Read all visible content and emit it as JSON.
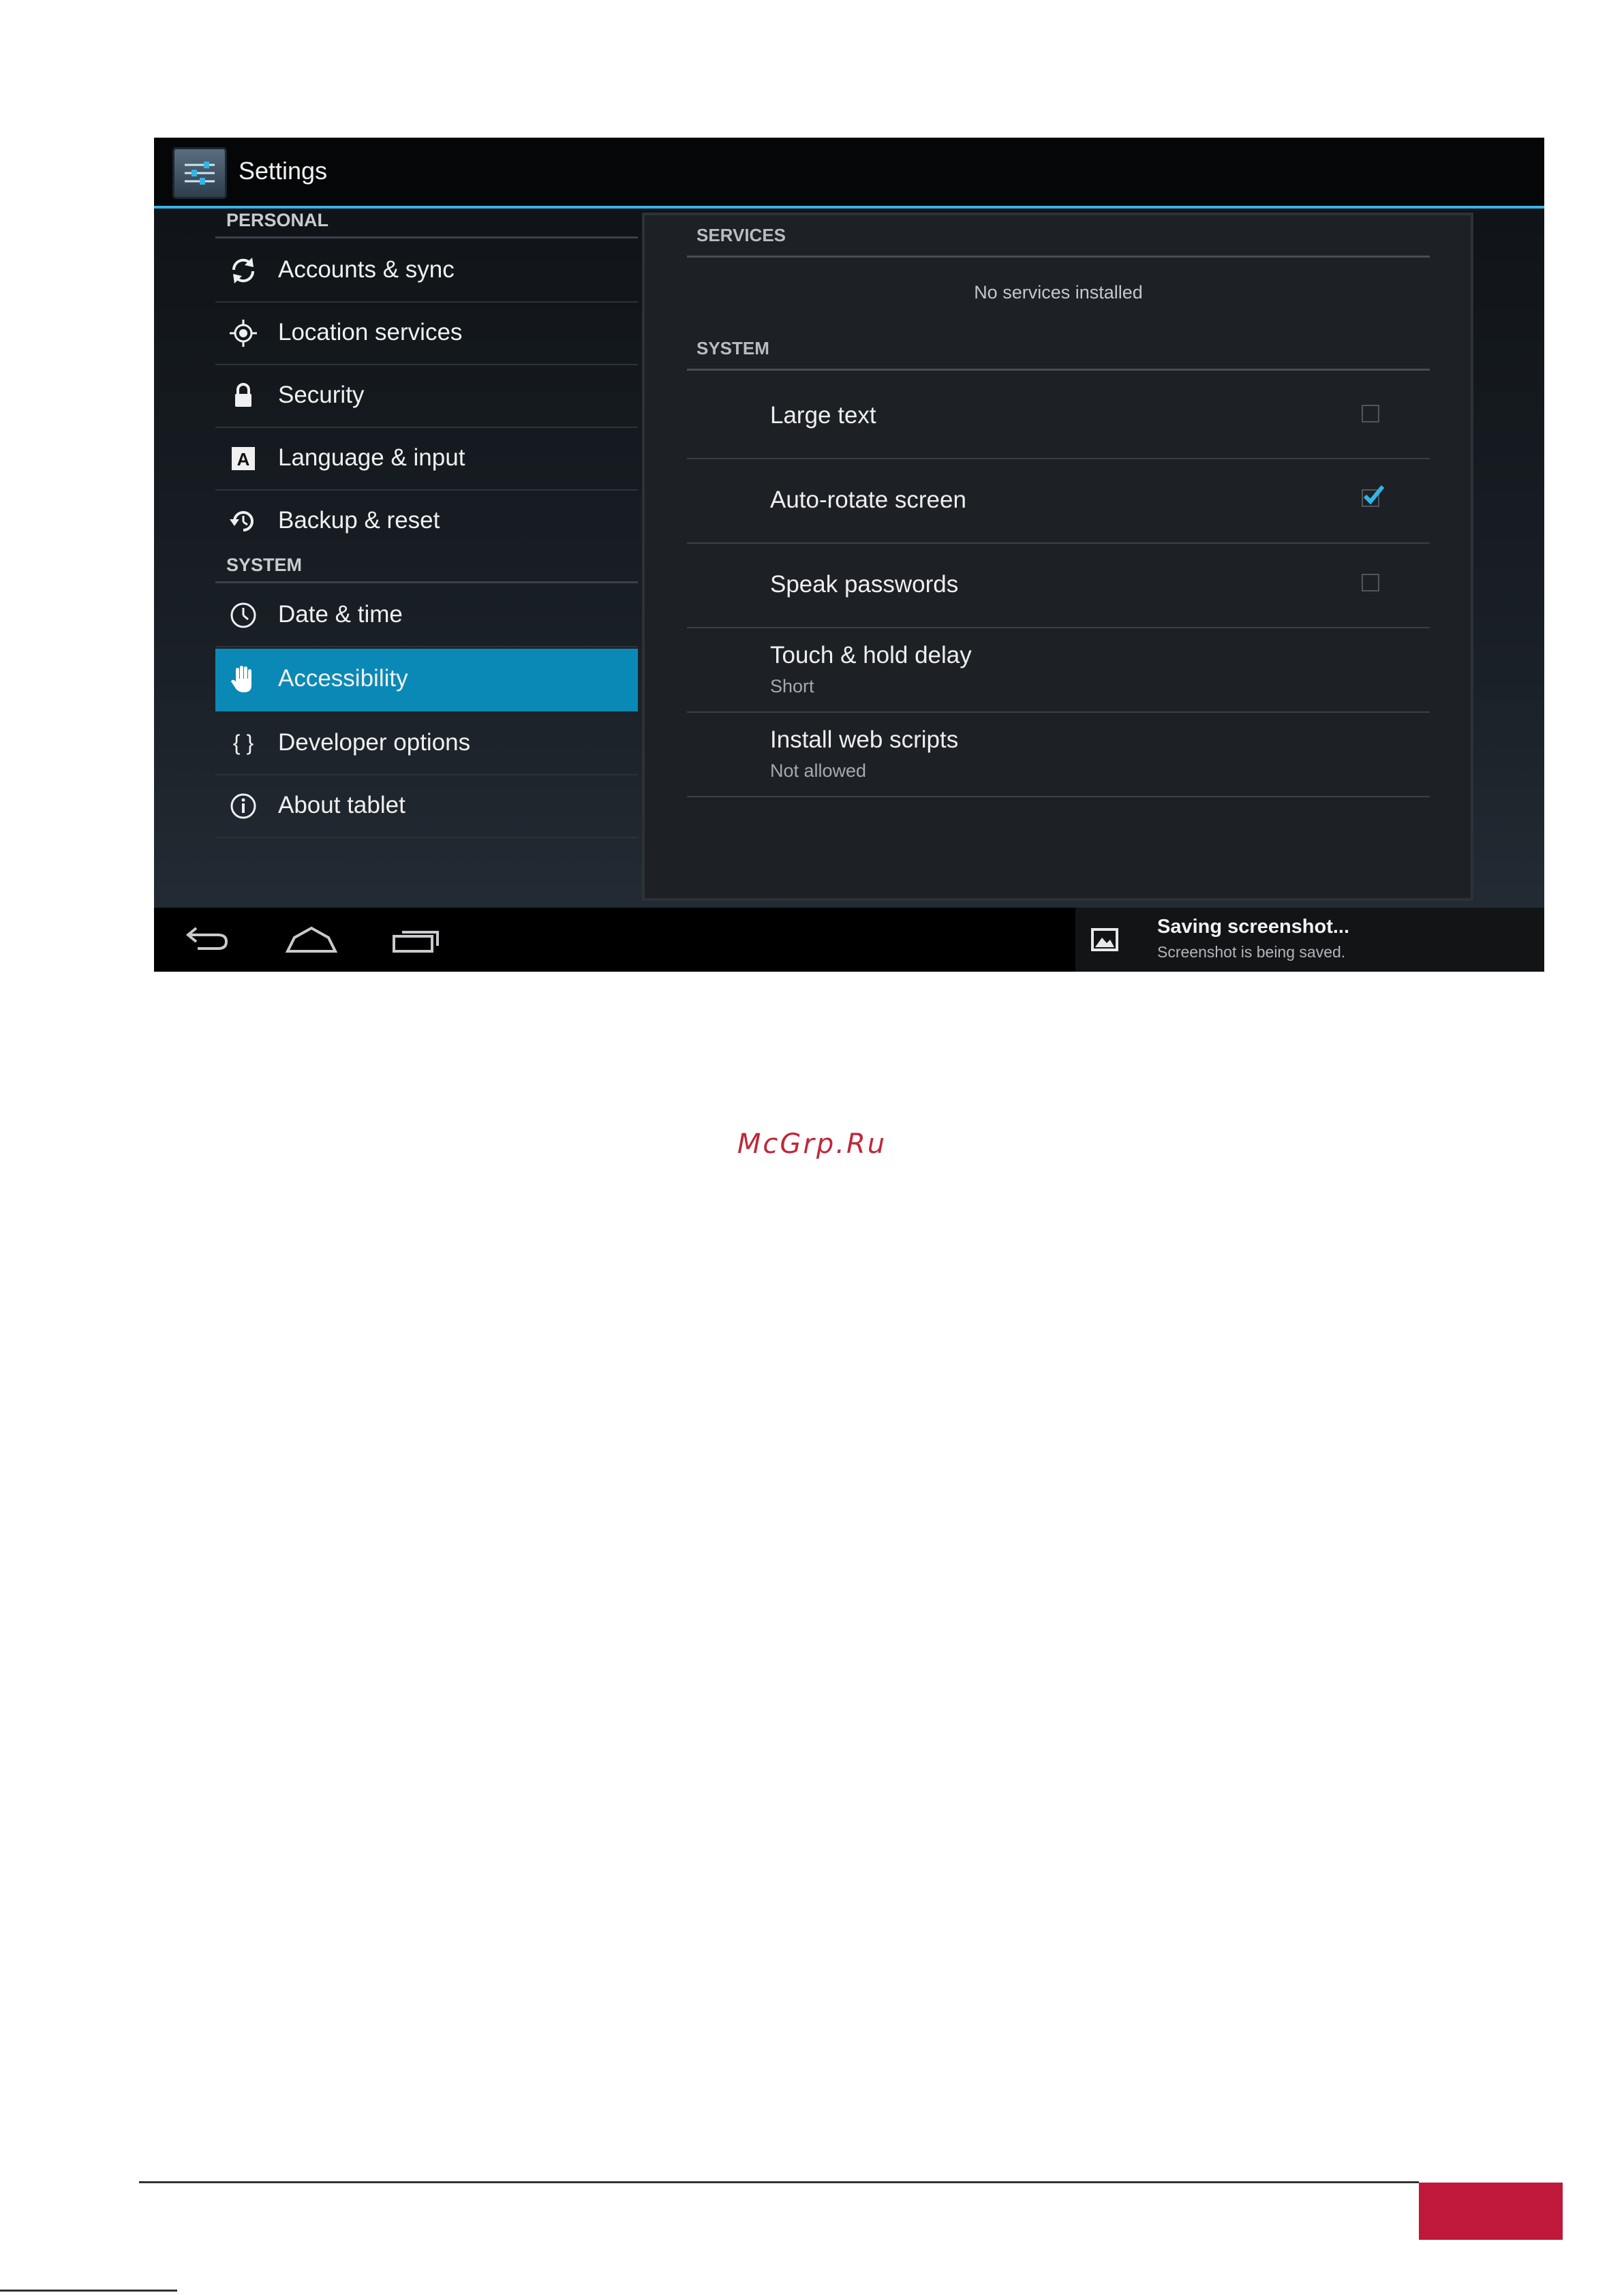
{
  "app": {
    "title": "Settings"
  },
  "sidebar": {
    "personal_header": "PERSONAL",
    "system_header": "SYSTEM",
    "items": [
      {
        "label": "Accounts & sync",
        "icon": "sync-icon"
      },
      {
        "label": "Location services",
        "icon": "location-icon"
      },
      {
        "label": "Security",
        "icon": "lock-icon"
      },
      {
        "label": "Language & input",
        "icon": "language-icon"
      },
      {
        "label": "Backup & reset",
        "icon": "backup-icon"
      },
      {
        "label": "Date & time",
        "icon": "clock-icon"
      },
      {
        "label": "Accessibility",
        "icon": "hand-icon",
        "selected": true
      },
      {
        "label": "Developer options",
        "icon": "braces-icon"
      },
      {
        "label": "About tablet",
        "icon": "info-icon"
      }
    ]
  },
  "detail": {
    "services_header": "SERVICES",
    "no_services": "No services installed",
    "system_header": "SYSTEM",
    "prefs": [
      {
        "title": "Large text",
        "checked": false
      },
      {
        "title": "Auto-rotate screen",
        "checked": true
      },
      {
        "title": "Speak passwords",
        "checked": false
      },
      {
        "title": "Touch & hold delay",
        "summary": "Short"
      },
      {
        "title": "Install web scripts",
        "summary": "Not allowed"
      }
    ]
  },
  "notification": {
    "title": "Saving screenshot...",
    "text": "Screenshot is being saved."
  },
  "watermark": "McGrp.Ru",
  "colors": {
    "accent": "#33b5e5",
    "selected": "#0b89b6",
    "watermark": "#c0283a",
    "page_tab": "#c0183a"
  }
}
